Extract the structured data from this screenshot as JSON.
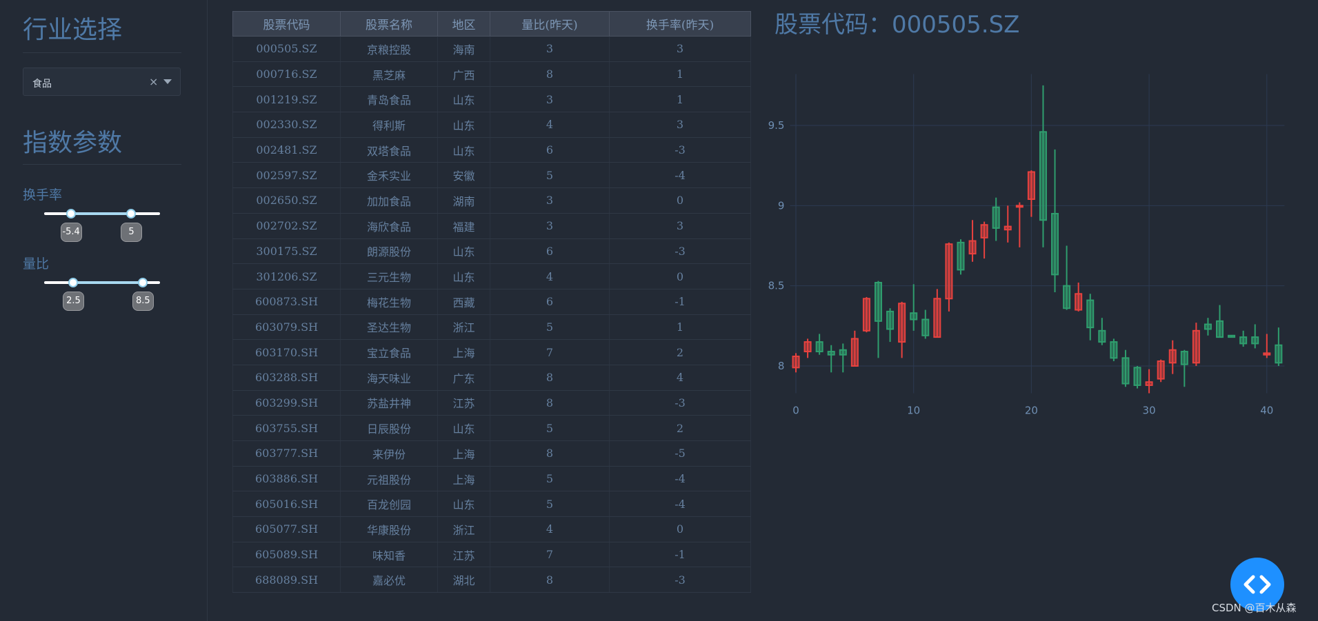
{
  "sidebar": {
    "industry_title": "行业选择",
    "industry_select": {
      "value": "食品",
      "clear_glyph": "×"
    },
    "params_title": "指数参数",
    "turnover": {
      "label": "换手率",
      "min": -5.4,
      "max": 5,
      "low_label": "-5.4",
      "high_label": "5",
      "range_min": -10,
      "range_max": 10
    },
    "volume_ratio": {
      "label": "量比",
      "min": 2.5,
      "max": 8.5,
      "low_label": "2.5",
      "high_label": "8.5",
      "range_min": 0,
      "range_max": 10
    }
  },
  "table": {
    "headers": [
      "股票代码",
      "股票名称",
      "地区",
      "量比(昨天)",
      "换手率(昨天)"
    ],
    "rows": [
      [
        "000505.SZ",
        "京粮控股",
        "海南",
        "3",
        "3"
      ],
      [
        "000716.SZ",
        "黑芝麻",
        "广西",
        "8",
        "1"
      ],
      [
        "001219.SZ",
        "青岛食品",
        "山东",
        "3",
        "1"
      ],
      [
        "002330.SZ",
        "得利斯",
        "山东",
        "4",
        "3"
      ],
      [
        "002481.SZ",
        "双塔食品",
        "山东",
        "6",
        "-3"
      ],
      [
        "002597.SZ",
        "金禾实业",
        "安徽",
        "5",
        "-4"
      ],
      [
        "002650.SZ",
        "加加食品",
        "湖南",
        "3",
        "0"
      ],
      [
        "002702.SZ",
        "海欣食品",
        "福建",
        "3",
        "3"
      ],
      [
        "300175.SZ",
        "朗源股份",
        "山东",
        "6",
        "-3"
      ],
      [
        "301206.SZ",
        "三元生物",
        "山东",
        "4",
        "0"
      ],
      [
        "600873.SH",
        "梅花生物",
        "西藏",
        "6",
        "-1"
      ],
      [
        "603079.SH",
        "圣达生物",
        "浙江",
        "5",
        "1"
      ],
      [
        "603170.SH",
        "宝立食品",
        "上海",
        "7",
        "2"
      ],
      [
        "603288.SH",
        "海天味业",
        "广东",
        "8",
        "4"
      ],
      [
        "603299.SH",
        "苏盐井神",
        "江苏",
        "8",
        "-3"
      ],
      [
        "603755.SH",
        "日辰股份",
        "山东",
        "5",
        "2"
      ],
      [
        "603777.SH",
        "来伊份",
        "上海",
        "8",
        "-5"
      ],
      [
        "603886.SH",
        "元祖股份",
        "上海",
        "5",
        "-4"
      ],
      [
        "605016.SH",
        "百龙创园",
        "山东",
        "5",
        "-4"
      ],
      [
        "605077.SH",
        "华康股份",
        "浙江",
        "4",
        "0"
      ],
      [
        "605089.SH",
        "味知香",
        "江苏",
        "7",
        "-1"
      ],
      [
        "688089.SH",
        "嘉必优",
        "湖北",
        "8",
        "-3"
      ]
    ]
  },
  "chart": {
    "title": "股票代码：000505.SZ"
  },
  "chart_data": {
    "type": "candlestick",
    "title": "股票代码：000505.SZ",
    "xlim": [
      -0.5,
      41.5
    ],
    "ylim": [
      7.83,
      9.82
    ],
    "x_ticks": [
      0,
      10,
      20,
      30,
      40
    ],
    "y_ticks": [
      8,
      8.5,
      9,
      9.5
    ],
    "y_tick_labels": [
      "8",
      "8.5",
      "9",
      "9.5"
    ],
    "grid": true,
    "colors": {
      "up": "#e8423f",
      "down": "#2f9e6e"
    },
    "candles": [
      {
        "x": 0,
        "open": 7.99,
        "high": 8.08,
        "low": 7.96,
        "close": 8.06
      },
      {
        "x": 1,
        "open": 8.09,
        "high": 8.17,
        "low": 8.05,
        "close": 8.15
      },
      {
        "x": 2,
        "open": 8.15,
        "high": 8.2,
        "low": 8.07,
        "close": 8.09
      },
      {
        "x": 3,
        "open": 8.09,
        "high": 8.13,
        "low": 7.96,
        "close": 8.07
      },
      {
        "x": 4,
        "open": 8.1,
        "high": 8.14,
        "low": 7.96,
        "close": 8.07
      },
      {
        "x": 5,
        "open": 8.0,
        "high": 8.22,
        "low": 8.0,
        "close": 8.17
      },
      {
        "x": 6,
        "open": 8.22,
        "high": 8.43,
        "low": 8.21,
        "close": 8.42
      },
      {
        "x": 7,
        "open": 8.52,
        "high": 8.53,
        "low": 8.05,
        "close": 8.28
      },
      {
        "x": 8,
        "open": 8.34,
        "high": 8.36,
        "low": 8.15,
        "close": 8.23
      },
      {
        "x": 9,
        "open": 8.15,
        "high": 8.4,
        "low": 8.05,
        "close": 8.39
      },
      {
        "x": 10,
        "open": 8.33,
        "high": 8.51,
        "low": 8.22,
        "close": 8.29
      },
      {
        "x": 11,
        "open": 8.29,
        "high": 8.35,
        "low": 8.17,
        "close": 8.19
      },
      {
        "x": 12,
        "open": 8.18,
        "high": 8.48,
        "low": 8.18,
        "close": 8.42
      },
      {
        "x": 13,
        "open": 8.42,
        "high": 8.77,
        "low": 8.34,
        "close": 8.76
      },
      {
        "x": 14,
        "open": 8.77,
        "high": 8.79,
        "low": 8.57,
        "close": 8.6
      },
      {
        "x": 15,
        "open": 8.7,
        "high": 8.91,
        "low": 8.65,
        "close": 8.78
      },
      {
        "x": 16,
        "open": 8.8,
        "high": 8.9,
        "low": 8.67,
        "close": 8.88
      },
      {
        "x": 17,
        "open": 8.99,
        "high": 9.05,
        "low": 8.78,
        "close": 8.86
      },
      {
        "x": 18,
        "open": 8.85,
        "high": 9.0,
        "low": 8.77,
        "close": 8.87
      },
      {
        "x": 19,
        "open": 9.0,
        "high": 9.02,
        "low": 8.74,
        "close": 9.0
      },
      {
        "x": 20,
        "open": 9.04,
        "high": 9.22,
        "low": 8.93,
        "close": 9.21
      },
      {
        "x": 21,
        "open": 9.46,
        "high": 9.75,
        "low": 8.74,
        "close": 8.91
      },
      {
        "x": 22,
        "open": 8.95,
        "high": 9.35,
        "low": 8.46,
        "close": 8.57
      },
      {
        "x": 23,
        "open": 8.5,
        "high": 8.75,
        "low": 8.35,
        "close": 8.36
      },
      {
        "x": 24,
        "open": 8.35,
        "high": 8.52,
        "low": 8.34,
        "close": 8.45
      },
      {
        "x": 25,
        "open": 8.41,
        "high": 8.45,
        "low": 8.16,
        "close": 8.24
      },
      {
        "x": 26,
        "open": 8.22,
        "high": 8.3,
        "low": 8.13,
        "close": 8.15
      },
      {
        "x": 27,
        "open": 8.15,
        "high": 8.17,
        "low": 8.03,
        "close": 8.05
      },
      {
        "x": 28,
        "open": 8.05,
        "high": 8.1,
        "low": 7.87,
        "close": 7.89
      },
      {
        "x": 29,
        "open": 7.99,
        "high": 8.0,
        "low": 7.86,
        "close": 7.88
      },
      {
        "x": 30,
        "open": 7.88,
        "high": 7.98,
        "low": 7.83,
        "close": 7.9
      },
      {
        "x": 31,
        "open": 7.92,
        "high": 8.04,
        "low": 7.9,
        "close": 8.03
      },
      {
        "x": 32,
        "open": 8.02,
        "high": 8.16,
        "low": 7.95,
        "close": 8.1
      },
      {
        "x": 33,
        "open": 8.09,
        "high": 8.1,
        "low": 7.87,
        "close": 8.01
      },
      {
        "x": 34,
        "open": 8.02,
        "high": 8.27,
        "low": 8.0,
        "close": 8.22
      },
      {
        "x": 35,
        "open": 8.26,
        "high": 8.3,
        "low": 8.19,
        "close": 8.23
      },
      {
        "x": 36,
        "open": 8.28,
        "high": 8.38,
        "low": 8.18,
        "close": 8.18
      },
      {
        "x": 37,
        "open": 8.19,
        "high": 8.19,
        "low": 8.18,
        "close": 8.18
      },
      {
        "x": 38,
        "open": 8.18,
        "high": 8.22,
        "low": 8.12,
        "close": 8.14
      },
      {
        "x": 39,
        "open": 8.18,
        "high": 8.26,
        "low": 8.11,
        "close": 8.14
      },
      {
        "x": 40,
        "open": 8.07,
        "high": 8.2,
        "low": 8.05,
        "close": 8.08
      },
      {
        "x": 41,
        "open": 8.13,
        "high": 8.24,
        "low": 8.0,
        "close": 8.02
      }
    ]
  },
  "fab": {
    "icon": "code-icon"
  },
  "watermark": "CSDN @百木从森"
}
